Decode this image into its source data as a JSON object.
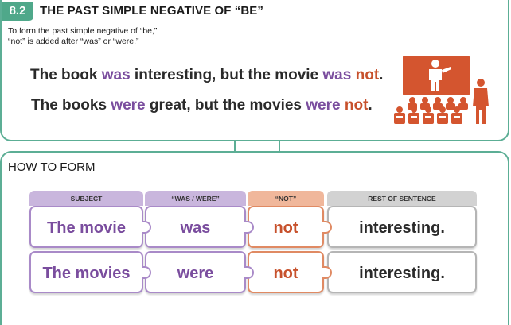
{
  "section": {
    "number": "8.2",
    "title": "THE PAST SIMPLE NEGATIVE OF “BE”",
    "intro_line1": "To form the past simple negative of “be,”",
    "intro_line2": "“not” is added after “was” or “were.”"
  },
  "examples": [
    {
      "before": "The book ",
      "verb": "was",
      "middle": " interesting, but the movie ",
      "verb2": "was",
      "space": " ",
      "not": "not",
      "end": "."
    },
    {
      "before": "The books ",
      "verb": "were",
      "middle": " great, but the movies ",
      "verb2": "were",
      "space": " ",
      "not": "not",
      "end": "."
    }
  ],
  "illustration": {
    "icon": "audience-watching-screen-icon"
  },
  "how_to_form": {
    "heading": "HOW TO FORM",
    "headers": {
      "subject": "SUBJECT",
      "verb": "“WAS / WERE”",
      "not": "“NOT”",
      "rest": "REST OF SENTENCE"
    },
    "rows": [
      {
        "subject": "The movie",
        "verb": "was",
        "not": "not",
        "rest": "interesting."
      },
      {
        "subject": "The movies",
        "verb": "were",
        "not": "not",
        "rest": "interesting."
      }
    ]
  },
  "colors": {
    "green": "#5cae95",
    "purple": "#7a4d9e",
    "orange": "#c7512c",
    "illustration": "#d4552f"
  }
}
